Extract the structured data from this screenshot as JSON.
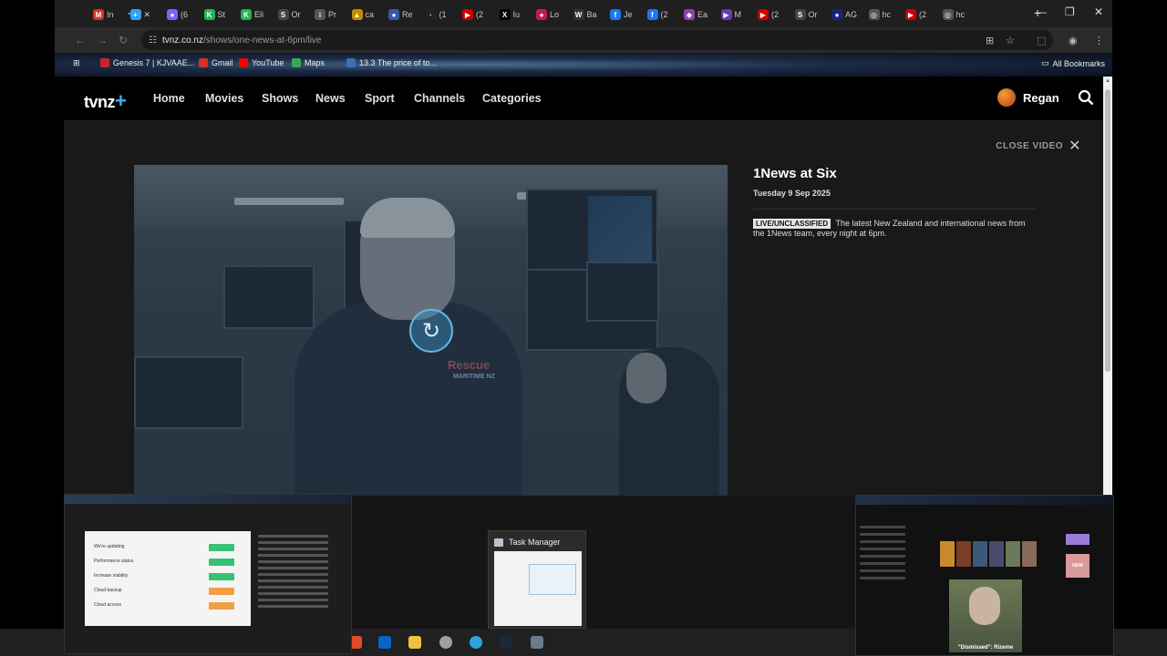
{
  "browser": {
    "tabs": [
      {
        "label": "In",
        "color": "#d93025",
        "glyph": "M"
      },
      {
        "label": "✕",
        "color": "#2ea3ff",
        "glyph": "+"
      },
      {
        "label": "(6",
        "color": "#7b61ff",
        "glyph": "●"
      },
      {
        "label": "St",
        "color": "#1db954",
        "glyph": "K"
      },
      {
        "label": "Eli",
        "color": "#1db954",
        "glyph": "K"
      },
      {
        "label": "Or",
        "color": "#444444",
        "glyph": "S"
      },
      {
        "label": "Pr",
        "color": "#555555",
        "glyph": "i"
      },
      {
        "label": "ca",
        "color": "#c28b00",
        "glyph": "▲"
      },
      {
        "label": "Re",
        "color": "#3a58a8",
        "glyph": "●"
      },
      {
        "label": "(1",
        "color": "#222222",
        "glyph": "·"
      },
      {
        "label": "(2",
        "color": "#cc0000",
        "glyph": "▶"
      },
      {
        "label": "Iu",
        "color": "#000000",
        "glyph": "X"
      },
      {
        "label": "Lo",
        "color": "#c2185b",
        "glyph": "●"
      },
      {
        "label": "Ba",
        "color": "#333333",
        "glyph": "W"
      },
      {
        "label": "Je",
        "color": "#1877f2",
        "glyph": "f"
      },
      {
        "label": "(2",
        "color": "#1877f2",
        "glyph": "f"
      },
      {
        "label": "Ea",
        "color": "#8e44ad",
        "glyph": "◆"
      },
      {
        "label": "M",
        "color": "#6a3ab2",
        "glyph": "▶"
      },
      {
        "label": "(2",
        "color": "#cc0000",
        "glyph": "▶"
      },
      {
        "label": "Or",
        "color": "#444444",
        "glyph": "S"
      },
      {
        "label": "AG",
        "color": "#1a237e",
        "glyph": "●"
      },
      {
        "label": "hc",
        "color": "#555555",
        "glyph": "◎"
      },
      {
        "label": "(2",
        "color": "#cc0000",
        "glyph": "▶"
      },
      {
        "label": "hc",
        "color": "#555555",
        "glyph": "◎"
      }
    ],
    "url_host": "tvnz.co.nz",
    "url_path": "/shows/one-news-at-6pm/live",
    "bookmarks": [
      {
        "label": "Genesis 7 | KJVAAE...",
        "color": "#c62828"
      },
      {
        "label": "Gmail",
        "color": "#d93025"
      },
      {
        "label": "YouTube",
        "color": "#ff0000"
      },
      {
        "label": "Maps",
        "color": "#34a853"
      },
      {
        "label": "13.3 The price of to...",
        "color": "#3a6fb5"
      }
    ],
    "all_bookmarks": "All Bookmarks"
  },
  "site": {
    "logo": "tvnz",
    "nav": [
      "Home",
      "Movies",
      "Shows",
      "News",
      "Sport",
      "Channels",
      "Categories"
    ],
    "user_name": "Regan",
    "close_video": "CLOSE VIDEO"
  },
  "video": {
    "rescue": "Rescue",
    "maritime": "MARITIME NZ"
  },
  "show": {
    "title": "1News at Six",
    "date": "Tuesday 9 Sep 2025",
    "badge": "LIVE/UNCLASSIFIED",
    "description": "The latest New Zealand and international news from the 1News team, every night at 6pm."
  },
  "taskbar": {
    "task_manager_label": "Task Manager",
    "thumb_caption": "\"Dismissed\": Rizeme"
  },
  "doc_rows": [
    {
      "label": "We're updating",
      "pill": "#38c172"
    },
    {
      "label": "Performance status",
      "pill": "#38c172"
    },
    {
      "label": "Increase stability",
      "pill": "#38c172"
    },
    {
      "label": "Cloud backup",
      "pill": "#f0a040"
    },
    {
      "label": "Cloud access",
      "pill": "#f0a040"
    }
  ]
}
